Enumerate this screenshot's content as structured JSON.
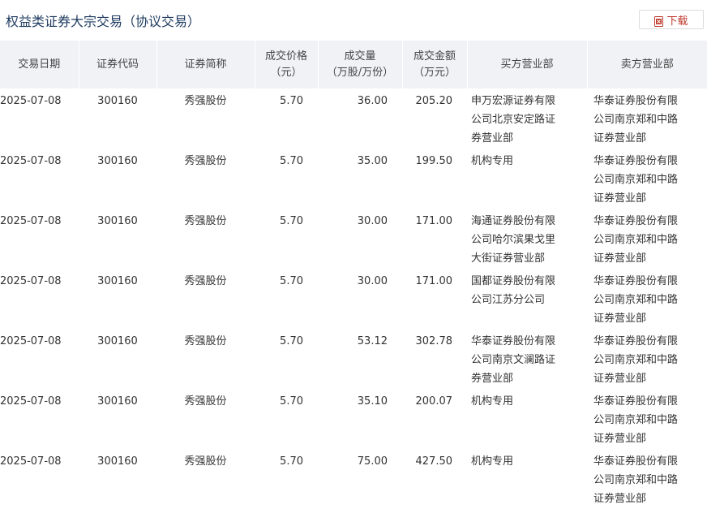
{
  "header": {
    "title": "权益类证券大宗交易（协议交易）",
    "download_label": "下载"
  },
  "table": {
    "columns": [
      [
        "交易日期"
      ],
      [
        "证券代码"
      ],
      [
        "证券简称"
      ],
      [
        "成交价格",
        "（元）"
      ],
      [
        "成交量",
        "（万股/万份）"
      ],
      [
        "成交金额",
        "（万元）"
      ],
      [
        "买方营业部"
      ],
      [
        "卖方营业部"
      ]
    ],
    "rows": [
      {
        "date": "2025-07-08",
        "code": "300160",
        "name": "秀强股份",
        "price": "5.70",
        "volume": "36.00",
        "amount": "205.20",
        "buyer": "申万宏源证券有限公司北京安定路证券营业部",
        "seller": "华泰证券股份有限公司南京郑和中路证券营业部"
      },
      {
        "date": "2025-07-08",
        "code": "300160",
        "name": "秀强股份",
        "price": "5.70",
        "volume": "35.00",
        "amount": "199.50",
        "buyer": "机构专用",
        "seller": "华泰证券股份有限公司南京郑和中路证券营业部"
      },
      {
        "date": "2025-07-08",
        "code": "300160",
        "name": "秀强股份",
        "price": "5.70",
        "volume": "30.00",
        "amount": "171.00",
        "buyer": "海通证券股份有限公司哈尔滨果戈里大街证券营业部",
        "seller": "华泰证券股份有限公司南京郑和中路证券营业部"
      },
      {
        "date": "2025-07-08",
        "code": "300160",
        "name": "秀强股份",
        "price": "5.70",
        "volume": "30.00",
        "amount": "171.00",
        "buyer": "国都证券股份有限公司江苏分公司",
        "seller": "华泰证券股份有限公司南京郑和中路证券营业部"
      },
      {
        "date": "2025-07-08",
        "code": "300160",
        "name": "秀强股份",
        "price": "5.70",
        "volume": "53.12",
        "amount": "302.78",
        "buyer": "华泰证券股份有限公司南京文澜路证券营业部",
        "seller": "华泰证券股份有限公司南京郑和中路证券营业部"
      },
      {
        "date": "2025-07-08",
        "code": "300160",
        "name": "秀强股份",
        "price": "5.70",
        "volume": "35.10",
        "amount": "200.07",
        "buyer": "机构专用",
        "seller": "华泰证券股份有限公司南京郑和中路证券营业部"
      },
      {
        "date": "2025-07-08",
        "code": "300160",
        "name": "秀强股份",
        "price": "5.70",
        "volume": "75.00",
        "amount": "427.50",
        "buyer": "机构专用",
        "seller": "华泰证券股份有限公司南京郑和中路证券营业部"
      }
    ]
  },
  "colors": {
    "title": "#1d3a5f",
    "download_accent": "#c0392b",
    "header_bg": "#f1f2f6"
  },
  "icons": {
    "download": "excel-file-icon"
  }
}
